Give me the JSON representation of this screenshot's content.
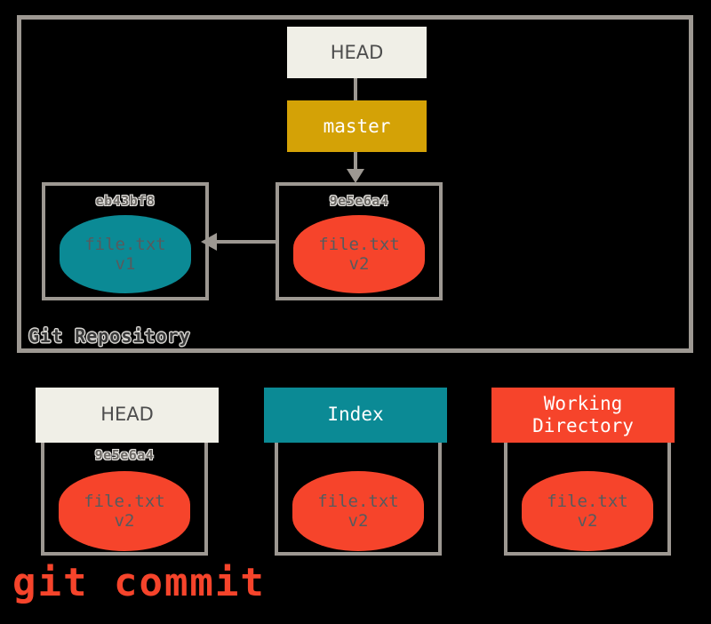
{
  "diagram": {
    "title": "git commit",
    "command_label": "git commit",
    "repository": {
      "label": "Git Repository",
      "pointers": [
        {
          "name": "HEAD",
          "label": "HEAD",
          "color": "#f0efe7",
          "text_color": "#4d4d4d"
        },
        {
          "name": "master",
          "label": "master",
          "color": "#d4a206",
          "text_color": "#ffffff"
        }
      ],
      "commits": [
        {
          "hash": "eb43bf8",
          "blob": {
            "filename": "file.txt",
            "version": "v1",
            "color": "#0b8a95"
          }
        },
        {
          "hash": "9e5e6a4",
          "blob": {
            "filename": "file.txt",
            "version": "v2",
            "color": "#f6442b"
          }
        }
      ]
    },
    "areas": [
      {
        "label": "HEAD",
        "header_color": "#f0efe7",
        "header_text_color": "#4d4d4d",
        "hash": "9e5e6a4",
        "blob": {
          "filename": "file.txt",
          "version": "v2",
          "color": "#f6442b"
        }
      },
      {
        "label": "Index",
        "header_color": "#0b8a95",
        "header_text_color": "#ffffff",
        "hash": "",
        "blob": {
          "filename": "file.txt",
          "version": "v2",
          "color": "#f6442b"
        }
      },
      {
        "label": "Working\nDirectory",
        "label_line1": "Working",
        "label_line2": "Directory",
        "header_color": "#f6442b",
        "header_text_color": "#ffffff",
        "hash": "",
        "blob": {
          "filename": "file.txt",
          "version": "v2",
          "color": "#f6442b"
        }
      }
    ],
    "colors": {
      "background": "#000000",
      "frame": "#9d9892",
      "blob_teal": "#0b8a95",
      "blob_red": "#f6442b",
      "branch_gold": "#d4a206",
      "head_cream": "#f0efe7",
      "blob_text": "#565b5e"
    }
  }
}
